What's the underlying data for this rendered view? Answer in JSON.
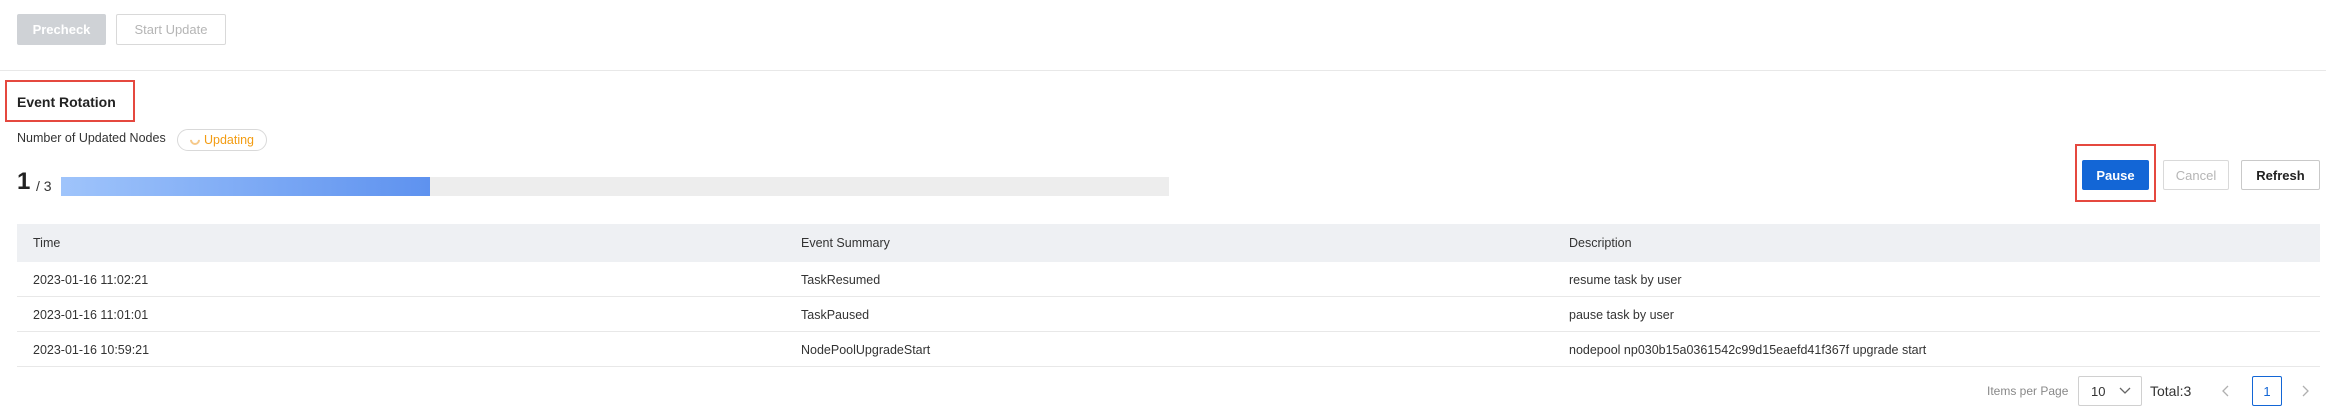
{
  "toolbar": {
    "precheck_label": "Precheck",
    "start_update_label": "Start Update"
  },
  "section": {
    "title": "Event Rotation",
    "nodes_label": "Number of Updated Nodes",
    "status_badge": "Updating",
    "status_color": "#f39c12"
  },
  "progress": {
    "updated": "1",
    "total_text": "/ 3",
    "fraction": 0.333
  },
  "actions": {
    "pause_label": "Pause",
    "cancel_label": "Cancel",
    "refresh_label": "Refresh",
    "accent_color": "#1366d6"
  },
  "table": {
    "headers": [
      "Time",
      "Event Summary",
      "Description"
    ],
    "rows": [
      [
        "2023-01-16 11:02:21",
        "TaskResumed",
        "resume task by user"
      ],
      [
        "2023-01-16 11:01:01",
        "TaskPaused",
        "pause task by user"
      ],
      [
        "2023-01-16 10:59:21",
        "NodePoolUpgradeStart",
        "nodepool np030b15a0361542c99d15eaefd41f367f upgrade start"
      ]
    ]
  },
  "pagination": {
    "items_per_page_label": "Items per Page",
    "page_size": "10",
    "total": "Total:3",
    "current_page": "1",
    "prev_icon": "chevron-left-icon",
    "next_icon": "chevron-right-icon"
  }
}
